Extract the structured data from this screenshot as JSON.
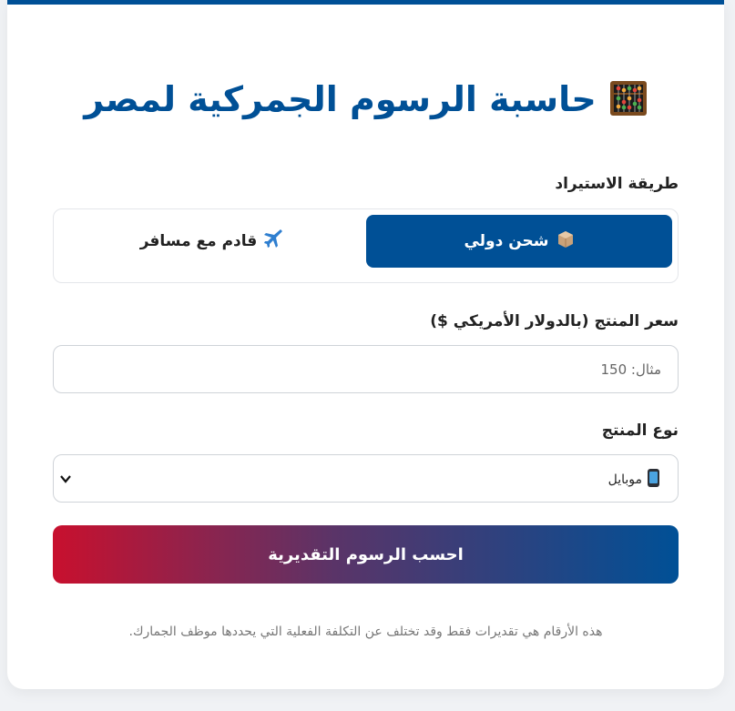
{
  "header": {
    "title": "حاسبة الرسوم الجمركية لمصر",
    "icon": "abacus-icon"
  },
  "import_method": {
    "label": "طريقة الاستيراد",
    "options": [
      {
        "label": "شحن دولي",
        "icon": "package-icon",
        "selected": true
      },
      {
        "label": "قادم مع مسافر",
        "icon": "airplane-icon",
        "selected": false
      }
    ]
  },
  "price": {
    "label": "سعر المنتج (بالدولار الأمريكي $)",
    "placeholder": "مثال: 150",
    "value": ""
  },
  "product_type": {
    "label": "نوع المنتج",
    "selected": "موبايل",
    "icon": "mobile-phone-icon"
  },
  "submit": {
    "label": "احسب الرسوم التقديرية"
  },
  "disclaimer": "هذه الأرقام هي تقديرات فقط وقد تختلف عن التكلفة الفعلية التي يحددها موظف الجمارك.",
  "colors": {
    "primary": "#005096",
    "accent_red": "#c8102e",
    "background": "#f0f2f5"
  }
}
